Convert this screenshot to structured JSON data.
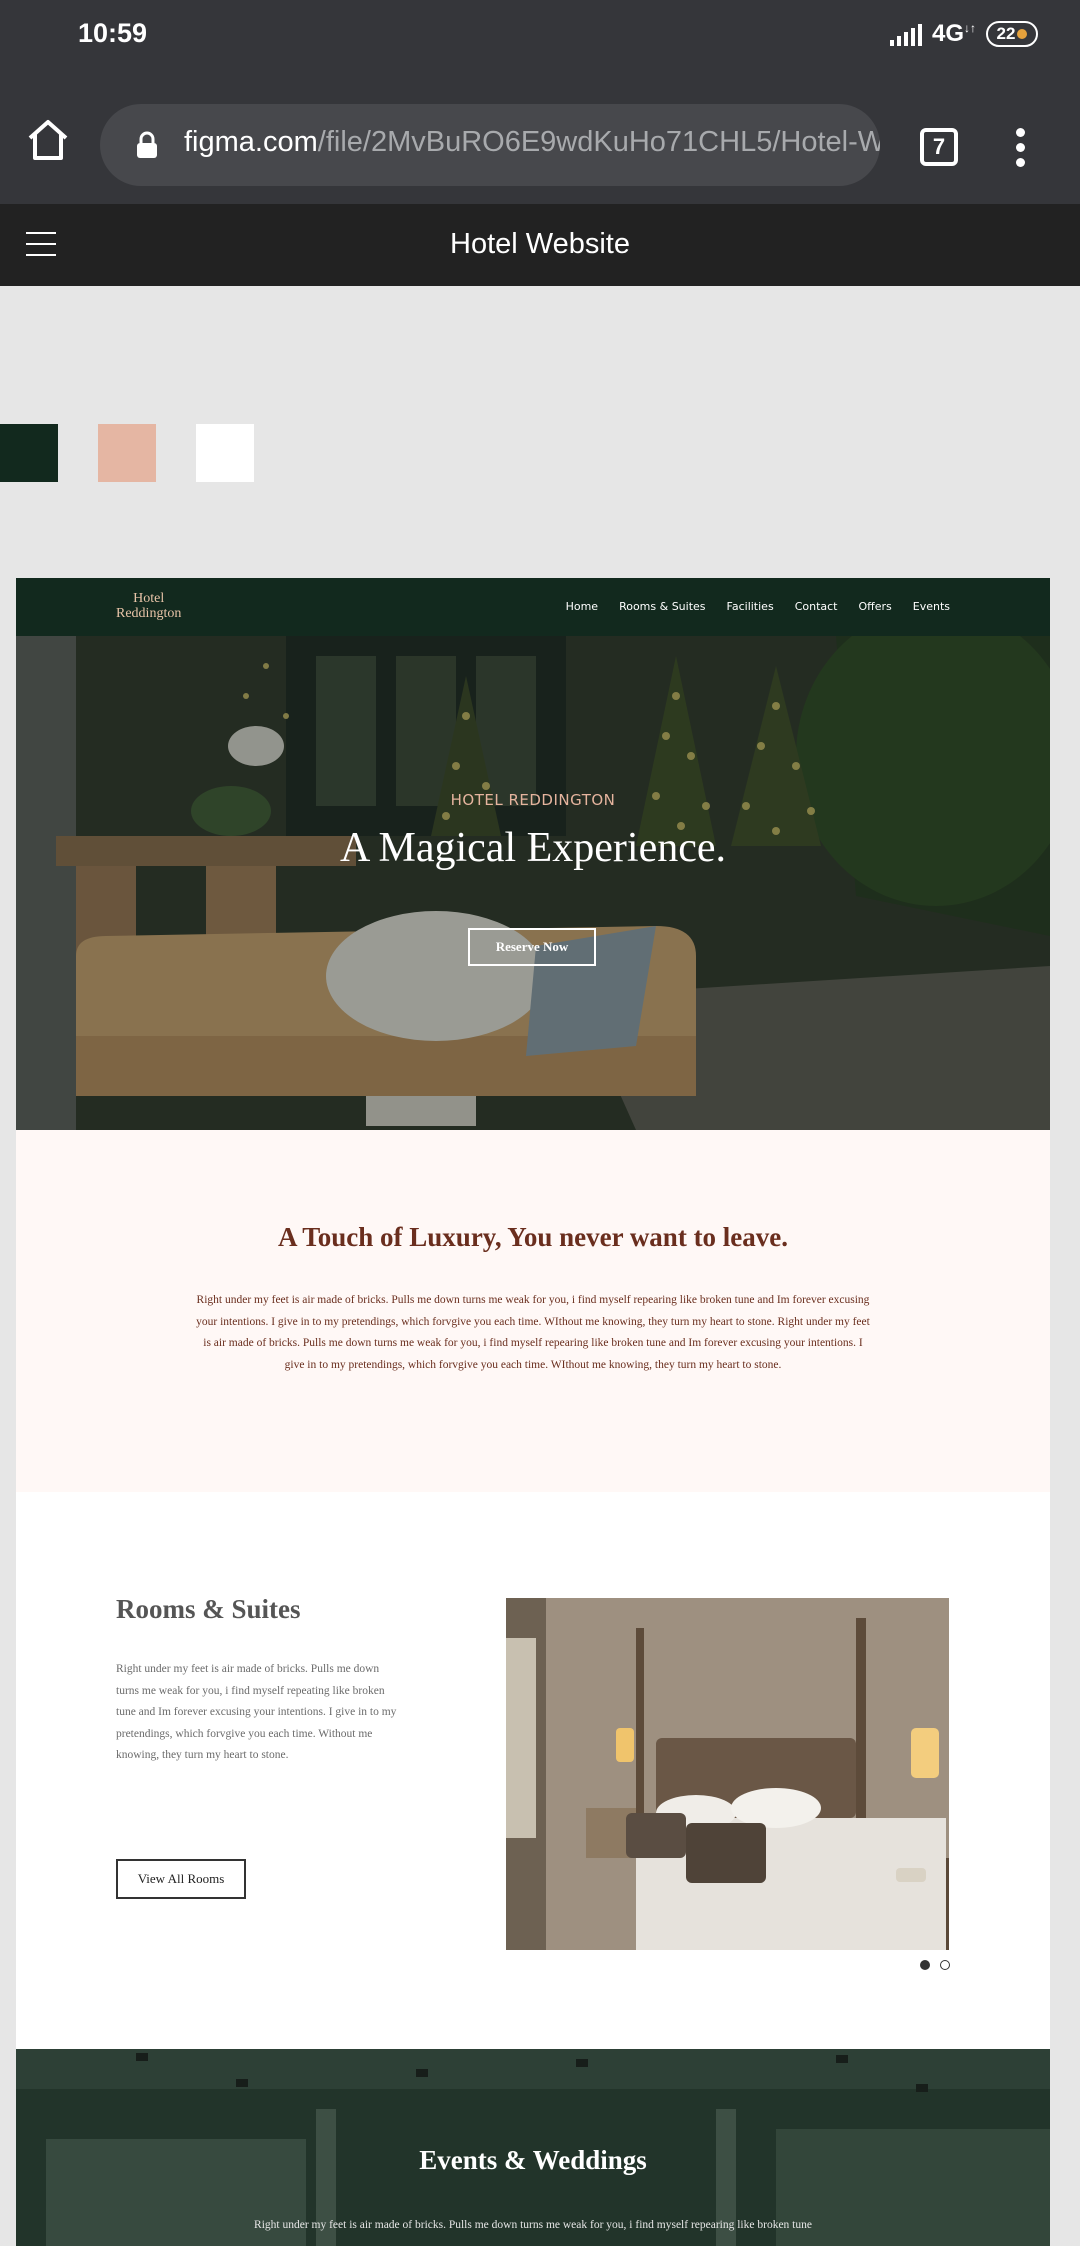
{
  "status_bar": {
    "time": "10:59",
    "network": "4G",
    "battery": "22"
  },
  "browser": {
    "url_domain": "figma.com",
    "url_path": "/file/2MvBuRO6E9wdKuHo71CHL5/Hotel-W",
    "tab_count": "7"
  },
  "figma": {
    "title": "Hotel Website"
  },
  "palette": {
    "dark_green": "#12291e",
    "peach": "#e5b6a3",
    "white": "#ffffff"
  },
  "site": {
    "logo_line1": "Hotel",
    "logo_line2": "Reddington",
    "nav": [
      "Home",
      "Rooms & Suites",
      "Facilities",
      "Contact",
      "Offers",
      "Events"
    ],
    "hero": {
      "kicker": "HOTEL REDDINGTON",
      "title": "A Magical Experience.",
      "button": "Reserve Now"
    },
    "luxury": {
      "title": "A Touch of Luxury, You never want to leave.",
      "text": "Right under my feet is air made of bricks. Pulls me down turns me weak for you, i find myself repearing like broken tune and Im forever excusing your intentions. I give in to my pretendings, which forvgive you each time. WIthout me knowing, they turn my heart to stone. Right under my feet is air made of bricks. Pulls me down turns me weak for you, i find myself repearing like broken tune and Im forever excusing your intentions. I give in to my pretendings, which forvgive you each time. WIthout me knowing, they turn my heart to stone."
    },
    "rooms": {
      "title": "Rooms & Suites",
      "text": "Right under my feet is air made of bricks. Pulls me down turns me weak for you, i find myself repeating like broken tune and Im forever excusing your intentions. I give in to my pretendings, which forvgive you each time. Without me knowing, they turn my heart to stone.",
      "button": "View All Rooms"
    },
    "events": {
      "title": "Events & Weddings",
      "text": "Right under my feet is air made of bricks. Pulls me down turns me weak for you, i find myself repearing like broken tune"
    }
  }
}
